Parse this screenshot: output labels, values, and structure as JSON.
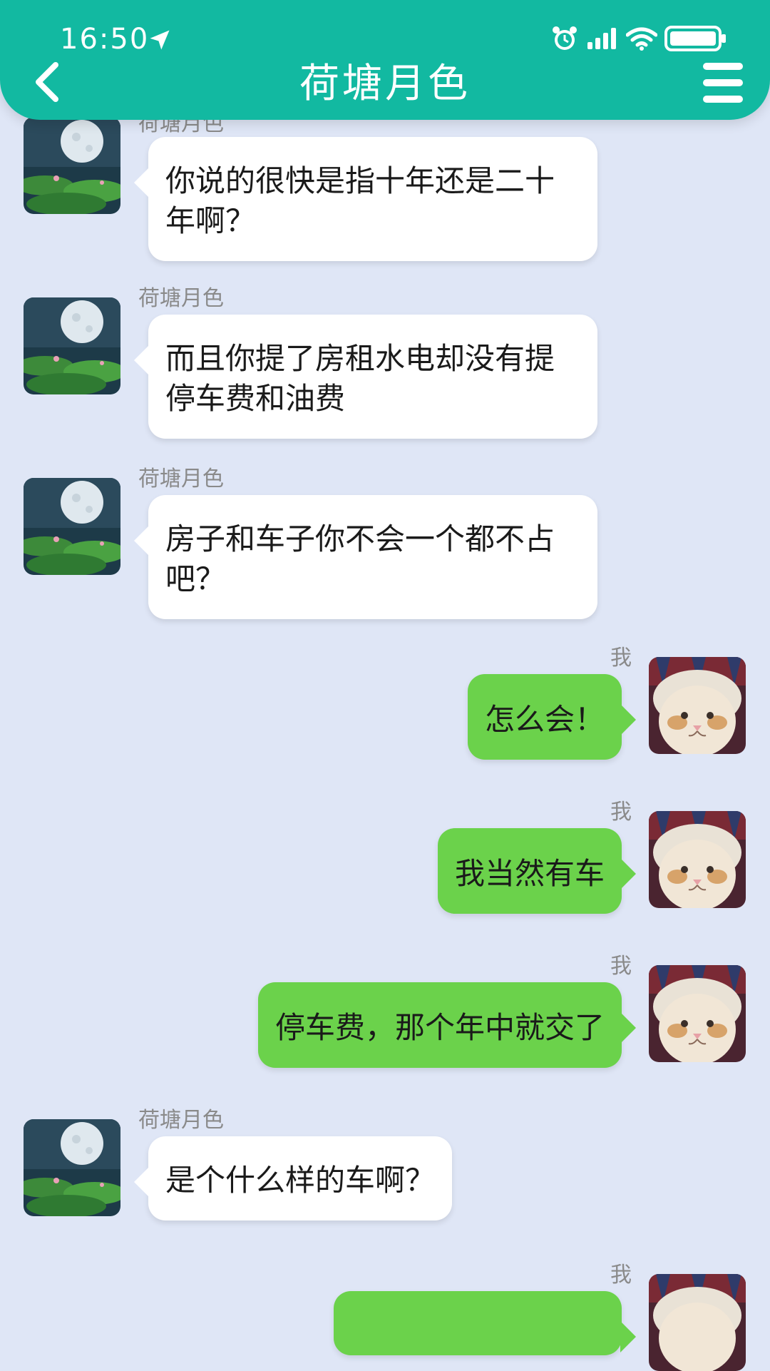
{
  "status_bar": {
    "time": "16:50",
    "icons": [
      "location-arrow-icon",
      "alarm-icon",
      "signal-icon",
      "wifi-icon",
      "battery-icon"
    ]
  },
  "header": {
    "title": "荷塘月色",
    "back_icon": "chevron-left-icon",
    "menu_icon": "hamburger-menu-icon"
  },
  "colors": {
    "header_bg": "#12b9a1",
    "chat_bg": "#dfe6f6",
    "incoming_bubble": "#ffffff",
    "outgoing_bubble": "#6bd24b"
  },
  "messages": [
    {
      "side": "in",
      "sender": "荷塘月色",
      "text": "你说的很快是指十年还是二十年啊？"
    },
    {
      "side": "in",
      "sender": "荷塘月色",
      "text": "而且你提了房租水电却没有提停车费和油费"
    },
    {
      "side": "in",
      "sender": "荷塘月色",
      "text": "房子和车子你不会一个都不占吧？"
    },
    {
      "side": "out",
      "sender": "我",
      "text": "怎么会！"
    },
    {
      "side": "out",
      "sender": "我",
      "text": "我当然有车"
    },
    {
      "side": "out",
      "sender": "我",
      "text": "停车费，那个年中就交了"
    },
    {
      "side": "in",
      "sender": "荷塘月色",
      "text": "是个什么样的车啊？"
    },
    {
      "side": "out",
      "sender": "我",
      "text": ""
    }
  ]
}
